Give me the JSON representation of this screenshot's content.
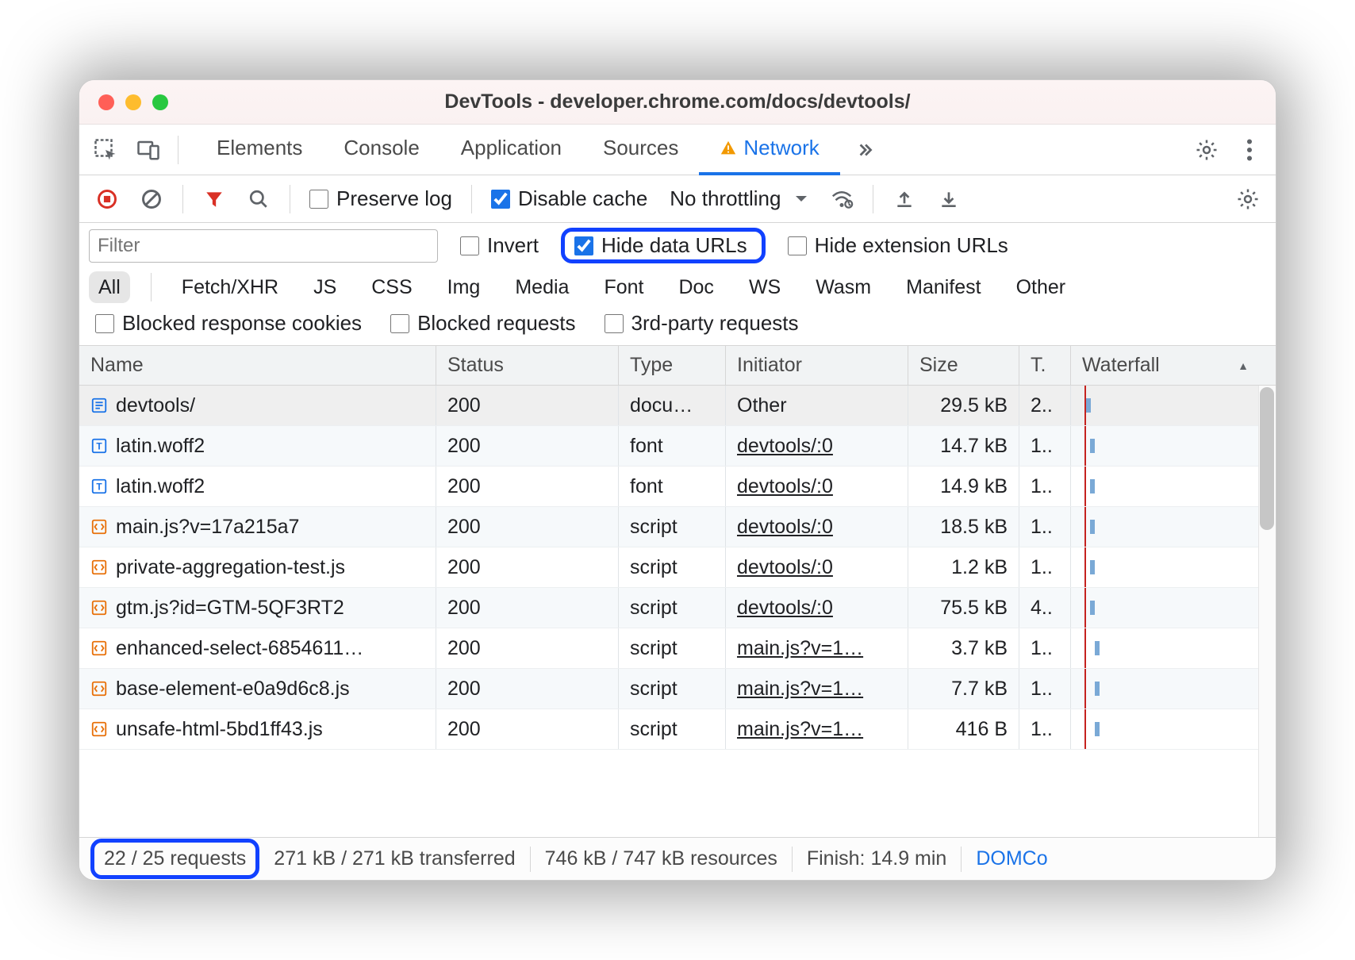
{
  "window": {
    "title": "DevTools - developer.chrome.com/docs/devtools/"
  },
  "tabs": {
    "items": [
      "Elements",
      "Console",
      "Application",
      "Sources",
      "Network"
    ],
    "activeIndex": 4,
    "warningOnActive": true
  },
  "toolbar": {
    "preserve_log": "Preserve log",
    "disable_cache": "Disable cache",
    "throttling": "No throttling"
  },
  "filter": {
    "placeholder": "Filter",
    "invert": "Invert",
    "hide_data_urls": "Hide data URLs",
    "hide_extension_urls": "Hide extension URLs",
    "types": [
      "All",
      "Fetch/XHR",
      "JS",
      "CSS",
      "Img",
      "Media",
      "Font",
      "Doc",
      "WS",
      "Wasm",
      "Manifest",
      "Other"
    ],
    "activeTypeIndex": 0,
    "blocked_response_cookies": "Blocked response cookies",
    "blocked_requests": "Blocked requests",
    "third_party": "3rd-party requests"
  },
  "columns": [
    "Name",
    "Status",
    "Type",
    "Initiator",
    "Size",
    "T.",
    "Waterfall"
  ],
  "rows": [
    {
      "icon": "doc",
      "name": "devtools/",
      "status": "200",
      "type": "docu…",
      "initiator": "Other",
      "initiatorLink": false,
      "size": "29.5 kB",
      "time": "2..",
      "wfLeft": 5,
      "wfW": 6
    },
    {
      "icon": "font",
      "name": "latin.woff2",
      "status": "200",
      "type": "font",
      "initiator": "devtools/:0",
      "initiatorLink": true,
      "size": "14.7 kB",
      "time": "1..",
      "wfLeft": 10,
      "wfW": 6
    },
    {
      "icon": "font",
      "name": "latin.woff2",
      "status": "200",
      "type": "font",
      "initiator": "devtools/:0",
      "initiatorLink": true,
      "size": "14.9 kB",
      "time": "1..",
      "wfLeft": 10,
      "wfW": 6
    },
    {
      "icon": "js",
      "name": "main.js?v=17a215a7",
      "status": "200",
      "type": "script",
      "initiator": "devtools/:0",
      "initiatorLink": true,
      "size": "18.5 kB",
      "time": "1..",
      "wfLeft": 10,
      "wfW": 6
    },
    {
      "icon": "js",
      "name": "private-aggregation-test.js",
      "status": "200",
      "type": "script",
      "initiator": "devtools/:0",
      "initiatorLink": true,
      "size": "1.2 kB",
      "time": "1..",
      "wfLeft": 10,
      "wfW": 6
    },
    {
      "icon": "js",
      "name": "gtm.js?id=GTM-5QF3RT2",
      "status": "200",
      "type": "script",
      "initiator": "devtools/:0",
      "initiatorLink": true,
      "size": "75.5 kB",
      "time": "4..",
      "wfLeft": 10,
      "wfW": 6
    },
    {
      "icon": "js",
      "name": "enhanced-select-6854611…",
      "status": "200",
      "type": "script",
      "initiator": "main.js?v=1…",
      "initiatorLink": true,
      "size": "3.7 kB",
      "time": "1..",
      "wfLeft": 16,
      "wfW": 6
    },
    {
      "icon": "js",
      "name": "base-element-e0a9d6c8.js",
      "status": "200",
      "type": "script",
      "initiator": "main.js?v=1…",
      "initiatorLink": true,
      "size": "7.7 kB",
      "time": "1..",
      "wfLeft": 16,
      "wfW": 6
    },
    {
      "icon": "js",
      "name": "unsafe-html-5bd1ff43.js",
      "status": "200",
      "type": "script",
      "initiator": "main.js?v=1…",
      "initiatorLink": true,
      "size": "416 B",
      "time": "1..",
      "wfLeft": 16,
      "wfW": 6
    }
  ],
  "waterfall": {
    "markerLeftPx": 3
  },
  "status": {
    "requests": "22 / 25 requests",
    "transferred": "271 kB / 271 kB transferred",
    "resources": "746 kB / 747 kB resources",
    "finish": "Finish: 14.9 min",
    "domcontent": "DOMCo"
  }
}
